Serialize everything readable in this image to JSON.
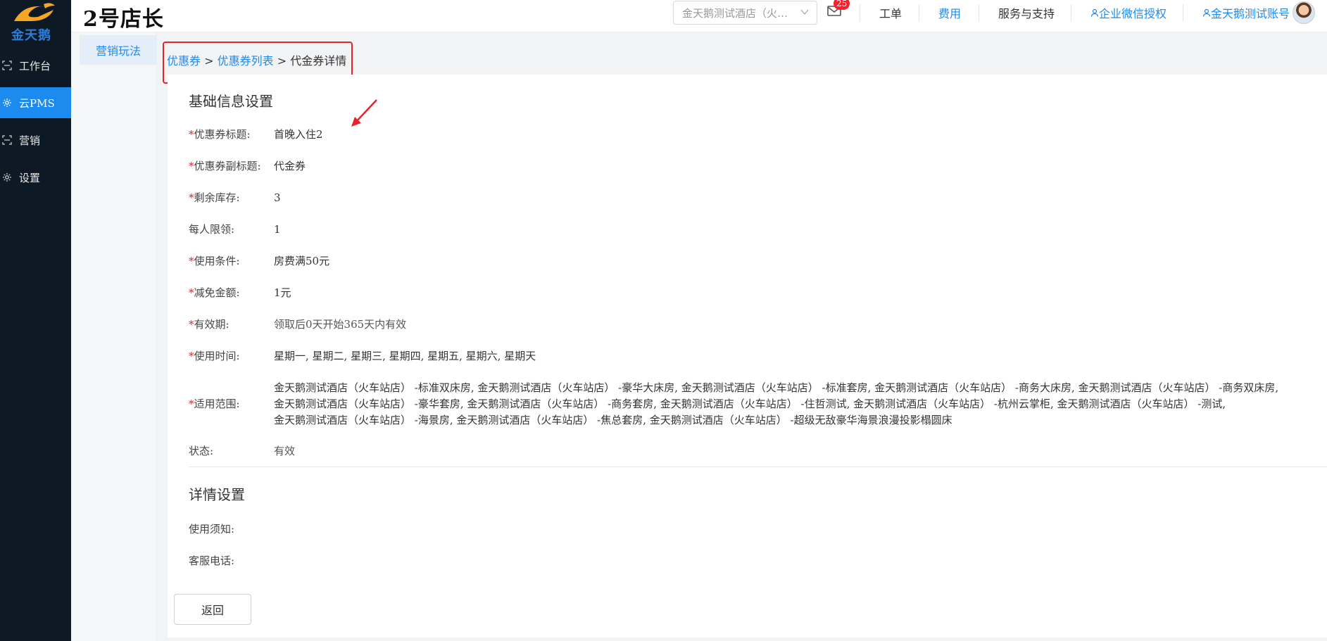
{
  "sidebar": {
    "logo_text": "金天鹅",
    "items": [
      {
        "label": "工作台",
        "icon": "workspace-icon",
        "active": false
      },
      {
        "label": "云PMS",
        "icon": "gear-icon",
        "active": true
      },
      {
        "label": "营销",
        "icon": "marketing-icon",
        "active": false
      },
      {
        "label": "设置",
        "icon": "gear-icon",
        "active": false
      }
    ]
  },
  "submenu": {
    "active_item": "营销玩法"
  },
  "header": {
    "brand": "2号店长",
    "hotel_select_value": "金天鹅测试酒店（火…",
    "mail_count": "25",
    "nav": {
      "work_order": "工单",
      "fees": "费用",
      "service": "服务与支持",
      "wechat_auth": "企业微信授权",
      "account": "金天鹅测试账号"
    }
  },
  "breadcrumb": {
    "level1": "优惠券",
    "level2": "优惠券列表",
    "current": "代金券详情",
    "sep": " > "
  },
  "basic": {
    "title": "基础信息设置",
    "fields": {
      "coupon_title": {
        "label": "优惠券标题:",
        "value": "首晚入住2",
        "required": true
      },
      "coupon_subtitle": {
        "label": "优惠券副标题:",
        "value": "代金券",
        "required": true
      },
      "stock": {
        "label": "剩余库存:",
        "value": "3",
        "required": true
      },
      "limit": {
        "label": "每人限领:",
        "value": "1",
        "required": false
      },
      "condition": {
        "label": "使用条件:",
        "value": "房费满50元",
        "required": true
      },
      "discount": {
        "label": "减免金额:",
        "value": "1元",
        "required": true
      },
      "validity": {
        "label": "有效期:",
        "value": "领取后0天开始365天内有效",
        "required": true
      },
      "use_time": {
        "label": "使用时间:",
        "value": "星期一, 星期二, 星期三, 星期四, 星期五, 星期六, 星期天",
        "required": true
      },
      "scope": {
        "label": "适用范围:",
        "required": true,
        "lines": [
          "金天鹅测试酒店（火车站店） -标准双床房, 金天鹅测试酒店（火车站店） -豪华大床房, 金天鹅测试酒店（火车站店） -标准套房, 金天鹅测试酒店（火车站店） -商务大床房, 金天鹅测试酒店（火车站店） -商务双床房,",
          "金天鹅测试酒店（火车站店） -豪华套房, 金天鹅测试酒店（火车站店） -商务套房, 金天鹅测试酒店（火车站店） -住哲测试, 金天鹅测试酒店（火车站店） -杭州云掌柜, 金天鹅测试酒店（火车站店） -测试,",
          "金天鹅测试酒店（火车站店） -海景房, 金天鹅测试酒店（火车站店） -焦总套房, 金天鹅测试酒店（火车站店） -超级无敌豪华海景浪漫投影榻圆床"
        ]
      },
      "status": {
        "label": "状态:",
        "value": "有效",
        "required": false
      }
    }
  },
  "detail": {
    "title": "详情设置",
    "notice_label": "使用须知:",
    "phone_label": "客服电话:"
  },
  "buttons": {
    "back": "返回"
  },
  "colors": {
    "sidebar_bg": "#0d1a26",
    "accent": "#1b8bf0",
    "required": "#e8212b",
    "highlight_box": "#e8212b"
  }
}
